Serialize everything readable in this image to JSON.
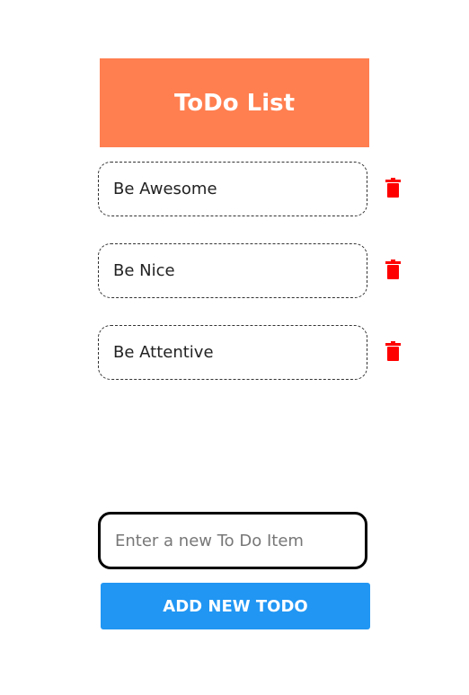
{
  "header": {
    "title": "ToDo List"
  },
  "todos": [
    {
      "text": "Be Awesome"
    },
    {
      "text": "Be Nice"
    },
    {
      "text": "Be Attentive"
    }
  ],
  "form": {
    "placeholder": "Enter a new To Do Item",
    "value": "",
    "add_label": "ADD NEW TODO"
  },
  "colors": {
    "header": "#FF7F50",
    "button": "#2196F3",
    "delete": "#FF0000"
  }
}
